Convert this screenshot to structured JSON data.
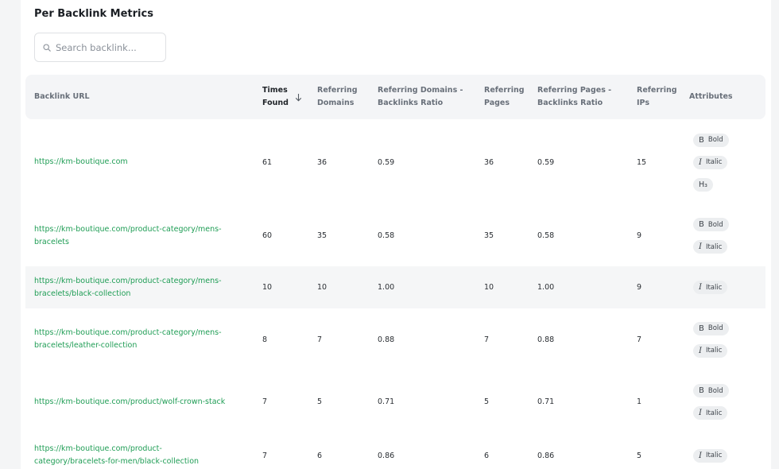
{
  "title": "Per Backlink Metrics",
  "search": {
    "placeholder": "Search backlink..."
  },
  "columns": {
    "url": "Backlink URL",
    "times_found": "Times\nFound",
    "ref_domains": "Referring\nDomains",
    "ref_domains_ratio": "Referring Domains -\nBacklinks Ratio",
    "ref_pages": "Referring\nPages",
    "ref_pages_ratio": "Referring Pages -\nBacklinks Ratio",
    "ref_ips": "Referring\nIPs",
    "attributes": "Attributes"
  },
  "attribute_labels": {
    "bold": "Bold",
    "italic": "Italic",
    "h3": "H3"
  },
  "glyphs": {
    "bold": "B",
    "italic": "I",
    "h3": "H₃"
  },
  "rows": [
    {
      "url": "https://km-boutique.com",
      "times_found": "61",
      "ref_domains": "36",
      "ref_domains_ratio": "0.59",
      "ref_pages": "36",
      "ref_pages_ratio": "0.59",
      "ref_ips": "15",
      "attributes": [
        "bold",
        "italic",
        "h3"
      ]
    },
    {
      "url": "https://km-boutique.com/product-category/mens-\nbracelets",
      "times_found": "60",
      "ref_domains": "35",
      "ref_domains_ratio": "0.58",
      "ref_pages": "35",
      "ref_pages_ratio": "0.58",
      "ref_ips": "9",
      "attributes": [
        "bold",
        "italic"
      ]
    },
    {
      "url": "https://km-boutique.com/product-category/mens-\nbracelets/black-collection",
      "times_found": "10",
      "ref_domains": "10",
      "ref_domains_ratio": "1.00",
      "ref_pages": "10",
      "ref_pages_ratio": "1.00",
      "ref_ips": "9",
      "attributes": [
        "italic"
      ]
    },
    {
      "url": "https://km-boutique.com/product-category/mens-\nbracelets/leather-collection",
      "times_found": "8",
      "ref_domains": "7",
      "ref_domains_ratio": "0.88",
      "ref_pages": "7",
      "ref_pages_ratio": "0.88",
      "ref_ips": "7",
      "attributes": [
        "bold",
        "italic"
      ]
    },
    {
      "url": "https://km-boutique.com/product/wolf-crown-stack",
      "times_found": "7",
      "ref_domains": "5",
      "ref_domains_ratio": "0.71",
      "ref_pages": "5",
      "ref_pages_ratio": "0.71",
      "ref_ips": "1",
      "attributes": [
        "bold",
        "italic"
      ]
    },
    {
      "url": "https://km-boutique.com/product-\ncategory/bracelets-for-men/black-collection",
      "times_found": "7",
      "ref_domains": "6",
      "ref_domains_ratio": "0.86",
      "ref_pages": "6",
      "ref_pages_ratio": "0.86",
      "ref_ips": "5",
      "attributes": [
        "italic"
      ]
    }
  ],
  "colors": {
    "link": "#1f9d55",
    "header_bg": "#f4f5f7",
    "row_highlight": "#f5f6f7",
    "chip_bg": "#eceef0"
  }
}
